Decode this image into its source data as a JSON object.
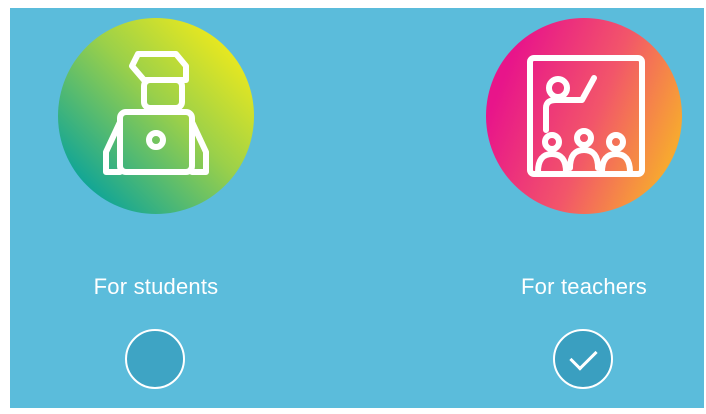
{
  "options": [
    {
      "label": "For students",
      "icon": "student-laptop-icon",
      "selected": false,
      "gradient": [
        "#0aa39a",
        "#f2eb1a"
      ]
    },
    {
      "label": "For teachers",
      "icon": "teacher-classroom-icon",
      "selected": true,
      "gradient": [
        "#e8158a",
        "#f7a830"
      ]
    }
  ],
  "colors": {
    "background": "#5bbcdb",
    "foreground": "#ffffff"
  }
}
